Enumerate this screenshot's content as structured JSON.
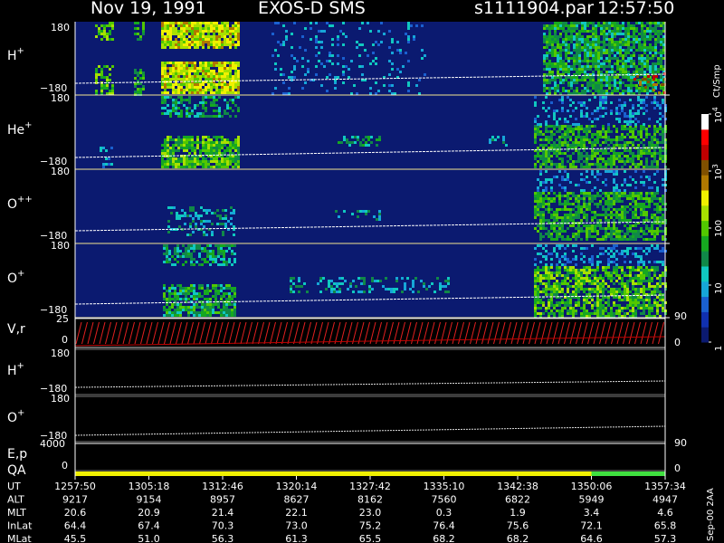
{
  "header": {
    "date": "Nov 19, 1991",
    "instrument": "EXOS-D SMS",
    "file": "s1111904.par",
    "time": "12:57:50"
  },
  "colorbar": {
    "unit": "Ct/Smp",
    "ticks": [
      {
        "value": 1,
        "label": "1"
      },
      {
        "value": 10,
        "label": "10"
      },
      {
        "value": 100,
        "label": "100"
      },
      {
        "value": 1000,
        "label": "10",
        "sup": "3"
      },
      {
        "value": 10000,
        "label": "10",
        "sup": "4"
      }
    ],
    "colors": [
      "#0b1a70",
      "#1030b0",
      "#1a60d0",
      "#16a6d8",
      "#10c8c0",
      "#108848",
      "#16a820",
      "#52c800",
      "#a8e000",
      "#f0f000",
      "#b07800",
      "#805000",
      "#c00000",
      "#ff0000",
      "#ffffff"
    ]
  },
  "panels": [
    {
      "label": "H",
      "sup": "+",
      "ytop": "180",
      "ybot": "−180"
    },
    {
      "label": "He",
      "sup": "+",
      "ytop": "180",
      "ybot": "−180"
    },
    {
      "label": "O",
      "sup": "++",
      "ytop": "180",
      "ybot": "−180"
    },
    {
      "label": "O",
      "sup": "+",
      "ytop": "180",
      "ybot": "−180"
    },
    {
      "label": "V,r",
      "sup": "",
      "ytop": "25",
      "ybot": "0",
      "rtop": "90",
      "rbot": "0"
    },
    {
      "label": "H",
      "sup": "+",
      "ytop": "180",
      "ybot": "−180"
    },
    {
      "label": "O",
      "sup": "+",
      "ytop": "180",
      "ybot": "−180"
    },
    {
      "label": "E,p",
      "sup": "",
      "ytop": "4000",
      "ybot": "0",
      "rtop": "90",
      "rbot": "0"
    }
  ],
  "qa_label": "QA",
  "axis_table": {
    "rows": [
      {
        "name": "UT",
        "values": [
          "1257:50",
          "1305:18",
          "1312:46",
          "1320:14",
          "1327:42",
          "1335:10",
          "1342:38",
          "1350:06",
          "1357:34"
        ]
      },
      {
        "name": "ALT",
        "values": [
          "9217",
          "9154",
          "8957",
          "8627",
          "8162",
          "7560",
          "6822",
          "5949",
          "4947"
        ]
      },
      {
        "name": "MLT",
        "values": [
          "20.6",
          "20.9",
          "21.4",
          "22.1",
          "23.0",
          "0.3",
          "1.9",
          "3.4",
          "4.6"
        ]
      },
      {
        "name": "InLat",
        "values": [
          "64.4",
          "67.4",
          "70.3",
          "73.0",
          "75.2",
          "76.4",
          "75.6",
          "72.1",
          "65.8"
        ]
      },
      {
        "name": "MLat",
        "values": [
          "45.5",
          "51.0",
          "56.3",
          "61.3",
          "65.5",
          "68.2",
          "68.2",
          "64.6",
          "57.3"
        ]
      }
    ]
  },
  "footer_stamp": "Sep-00 2AA",
  "chart_data": {
    "type": "heatmap",
    "title": "Nov 19, 1991   EXOS-D SMS",
    "x": [
      "1257:50",
      "1305:18",
      "1312:46",
      "1320:14",
      "1327:42",
      "1335:10",
      "1342:38",
      "1350:06",
      "1357:34"
    ],
    "xlabel": "UT",
    "color_scale": "log",
    "color_range": [
      1,
      10000
    ],
    "color_unit": "Ct/Smp",
    "series": [
      {
        "name": "H+",
        "ylim": [
          -180,
          180
        ]
      },
      {
        "name": "He+",
        "ylim": [
          -180,
          180
        ]
      },
      {
        "name": "O++",
        "ylim": [
          -180,
          180
        ]
      },
      {
        "name": "O+",
        "ylim": [
          -180,
          180
        ]
      }
    ],
    "lower_panels": [
      {
        "name": "V,r",
        "ylim": [
          0,
          25
        ],
        "ylim_right": [
          0,
          90
        ]
      },
      {
        "name": "H+",
        "ylim": [
          -180,
          180
        ]
      },
      {
        "name": "O+",
        "ylim": [
          -180,
          180
        ]
      },
      {
        "name": "E,p",
        "ylim": [
          0,
          4000
        ],
        "ylim_right": [
          0,
          90
        ]
      }
    ],
    "qa": [
      {
        "from": "1257:50",
        "to": "1350:06",
        "color": "#f0f000"
      },
      {
        "from": "1350:06",
        "to": "1357:34",
        "color": "#40e040"
      }
    ]
  }
}
